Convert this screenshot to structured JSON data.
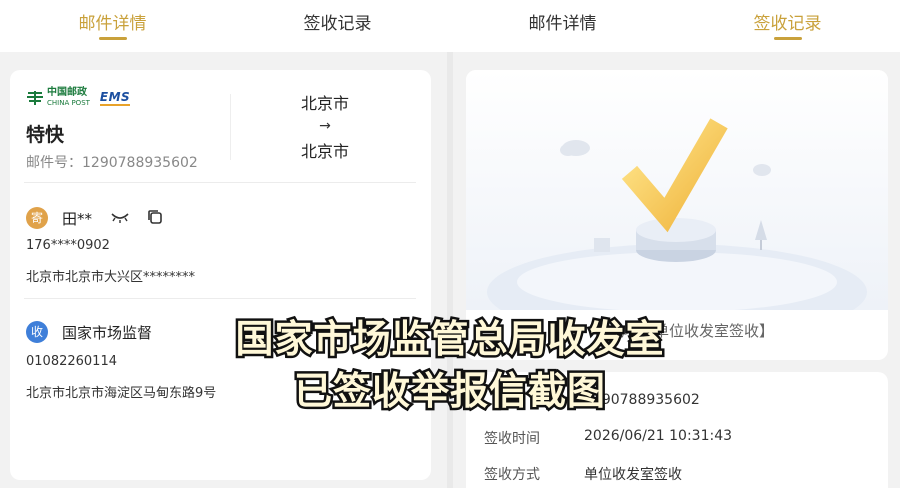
{
  "tabs_left": [
    {
      "label": "邮件详情",
      "active": true
    },
    {
      "label": "签收记录",
      "active": false
    }
  ],
  "tabs_right": [
    {
      "label": "邮件详情",
      "active": false
    },
    {
      "label": "签收记录",
      "active": true
    }
  ],
  "left_card": {
    "logo_chinapost_cn": "中国邮政",
    "logo_chinapost_en": "CHINA POST",
    "logo_ems": "EMS",
    "service": "特快",
    "mail_no_label": "邮件号：1290788935602",
    "route_from": "北京市",
    "route_arrow": "→",
    "route_to": "北京市",
    "sender": {
      "badge": "寄",
      "name": "田**",
      "phone": "176****0902",
      "address": "北京市北京市大兴区********"
    },
    "receiver": {
      "badge": "收",
      "name": "国家市场监督",
      "phone": "01082260114",
      "address": "北京市北京市海淀区马甸东路9号"
    }
  },
  "right_card": {
    "status": "已代收【单位收发室签收】"
  },
  "sign_info": {
    "rows": [
      {
        "label": "",
        "value": "1290788935602"
      },
      {
        "label": "签收时间",
        "value": "2026/06/21 10:31:43"
      },
      {
        "label": "签收方式",
        "value": "单位收发室签收"
      }
    ]
  },
  "caption": {
    "line1": "国家市场监管总局收发室",
    "line2": "已签收举报信截图"
  },
  "colors": {
    "accent": "#c9a13b",
    "sender_badge": "#e0a24a",
    "receiver_badge": "#3f7fd9"
  }
}
